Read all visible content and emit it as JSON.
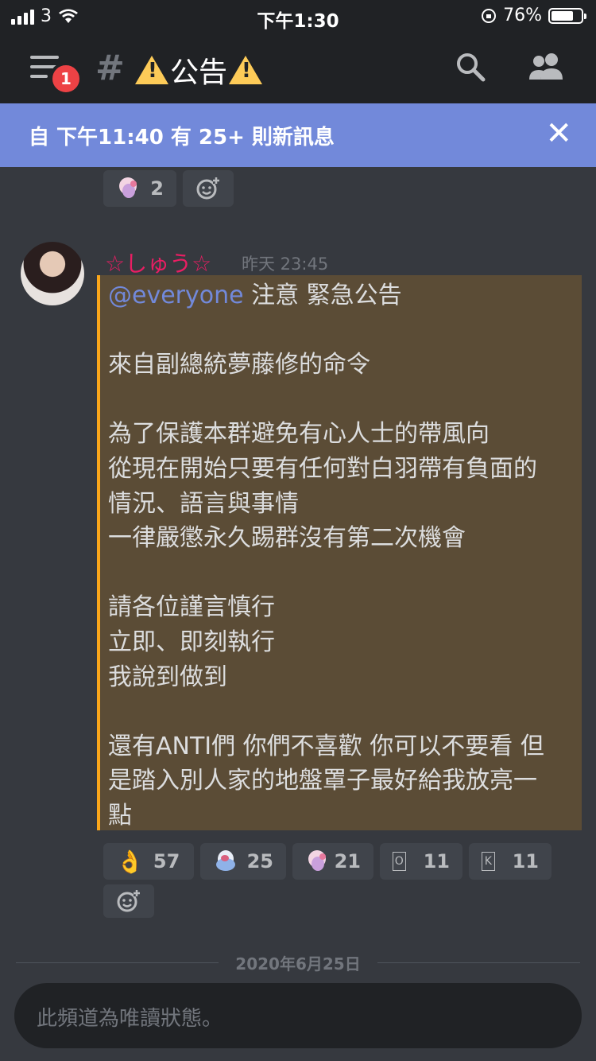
{
  "status_bar": {
    "carrier": "3",
    "time": "下午1:30",
    "battery_percent": "76%",
    "battery_level": 0.76
  },
  "header": {
    "menu_badge": "1",
    "hash": "#",
    "channel_name": "公告"
  },
  "new_messages_bar": {
    "text": "自 下午11:40 有 25+ 則新訊息"
  },
  "top_reactions": [
    {
      "emoji": "anime-sticker-icon",
      "count": "2"
    }
  ],
  "message": {
    "author": "☆しゅう☆",
    "timestamp": "昨天 23:45",
    "mention": "@everyone",
    "lines": [
      " 注意 緊急公告",
      "",
      "來自副總統夢藤修的命令",
      "",
      "為了保護本群避免有心人士的帶風向",
      "從現在開始只要有任何對白羽帶有負面的",
      "情況、語言與事情",
      "一律嚴懲永久踢群沒有第二次機會",
      "",
      "請各位謹言慎行",
      "立即、即刻執行",
      "我說到做到",
      "",
      "還有ANTI們 你們不喜歡 你可以不要看 但",
      "是踏入別人家的地盤罩子最好給我放亮一",
      "點"
    ],
    "reactions": [
      {
        "emoji": "👌",
        "count": "57"
      },
      {
        "emoji": "anime-sticker-icon",
        "count": "25"
      },
      {
        "emoji": "anime-sticker-icon",
        "count": "21"
      },
      {
        "emoji": "🇴",
        "count": "11"
      },
      {
        "emoji": "🇰",
        "count": "11"
      }
    ]
  },
  "date_divider": "2020年6月25日",
  "composer": {
    "placeholder": "此頻道為唯讀狀態。"
  },
  "colors": {
    "background": "#36393f",
    "header": "#202225",
    "accent": "#7289da",
    "username": "#e91e63",
    "announce_bg": "#5b4c36",
    "announce_border": "#faa61a"
  }
}
